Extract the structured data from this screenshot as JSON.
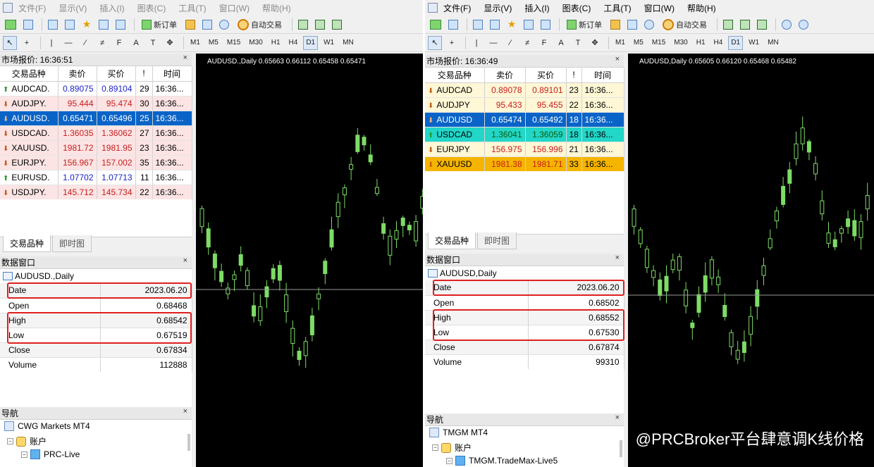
{
  "left": {
    "menu": [
      {
        "label": "文件(F)"
      },
      {
        "label": "显示(V)"
      },
      {
        "label": "插入(I)"
      },
      {
        "label": "图表(C)"
      },
      {
        "label": "工具(T)"
      },
      {
        "label": "窗口(W)"
      },
      {
        "label": "帮助(H)"
      }
    ],
    "toolbar": {
      "new_order": "新订单",
      "auto_trade": "自动交易"
    },
    "periods": [
      "M1",
      "M5",
      "M15",
      "M30",
      "H1",
      "H4",
      "D1",
      "W1",
      "MN"
    ],
    "active_period": "D1",
    "market_watch": {
      "title": "市场报价: 16:36:51",
      "columns": [
        "交易品种",
        "卖价",
        "买价",
        "!",
        "时间"
      ],
      "rows": [
        {
          "symbol": "AUDCAD.",
          "bid": "0.89075",
          "ask": "0.89104",
          "spread": "29",
          "time": "16:36...",
          "dir": "up",
          "bg": "#ffffff"
        },
        {
          "symbol": "AUDJPY.",
          "bid": "95.444",
          "ask": "95.474",
          "spread": "30",
          "time": "16:36...",
          "dir": "down",
          "bg": "#fde4e4"
        },
        {
          "symbol": "AUDUSD.",
          "bid": "0.65471",
          "ask": "0.65496",
          "spread": "25",
          "time": "16:36...",
          "dir": "down",
          "bg": "#0a64c8",
          "selected": true
        },
        {
          "symbol": "USDCAD.",
          "bid": "1.36035",
          "ask": "1.36062",
          "spread": "27",
          "time": "16:36...",
          "dir": "down",
          "bg": "#fde4e4"
        },
        {
          "symbol": "XAUUSD.",
          "bid": "1981.72",
          "ask": "1981.95",
          "spread": "23",
          "time": "16:36...",
          "dir": "down",
          "bg": "#fde4e4"
        },
        {
          "symbol": "EURJPY.",
          "bid": "156.967",
          "ask": "157.002",
          "spread": "35",
          "time": "16:36...",
          "dir": "down",
          "bg": "#fde4e4"
        },
        {
          "symbol": "EURUSD.",
          "bid": "1.07702",
          "ask": "1.07713",
          "spread": "11",
          "time": "16:36...",
          "dir": "up",
          "bg": "#ffffff"
        },
        {
          "symbol": "USDJPY.",
          "bid": "145.712",
          "ask": "145.734",
          "spread": "22",
          "time": "16:36...",
          "dir": "down",
          "bg": "#fde4e4"
        }
      ],
      "tabs": [
        "交易品种",
        "即时图"
      ]
    },
    "data_window": {
      "title": "数据窗口",
      "symbol": "AUDUSD.,Daily",
      "rows": [
        {
          "k": "Date",
          "v": "2023.06.20"
        },
        {
          "k": "Open",
          "v": "0.68468"
        },
        {
          "k": "High",
          "v": "0.68542"
        },
        {
          "k": "Low",
          "v": "0.67519"
        },
        {
          "k": "Close",
          "v": "0.67834"
        },
        {
          "k": "Volume",
          "v": "112888"
        }
      ]
    },
    "navigator": {
      "title": "导航",
      "broker": "CWG Markets MT4",
      "accounts": "账户",
      "server": "PRC-Live"
    },
    "chart": {
      "label": "AUDUSD.,Daily  0.65663 0.66112 0.65458 0.65471"
    }
  },
  "right": {
    "menu": [
      {
        "label": "文件(F)"
      },
      {
        "label": "显示(V)"
      },
      {
        "label": "插入(I)"
      },
      {
        "label": "图表(C)"
      },
      {
        "label": "工具(T)"
      },
      {
        "label": "窗口(W)"
      },
      {
        "label": "帮助(H)"
      }
    ],
    "toolbar": {
      "new_order": "新订单",
      "auto_trade": "自动交易"
    },
    "periods": [
      "M1",
      "M5",
      "M15",
      "M30",
      "H1",
      "H4",
      "D1",
      "W1",
      "MN"
    ],
    "active_period": "D1",
    "market_watch": {
      "title": "市场报价: 16:36:49",
      "columns": [
        "交易品种",
        "卖价",
        "买价",
        "!",
        "时间"
      ],
      "rows": [
        {
          "symbol": "AUDCAD",
          "bid": "0.89078",
          "ask": "0.89101",
          "spread": "23",
          "time": "16:36...",
          "dir": "down",
          "bg": "#fff7d6"
        },
        {
          "symbol": "AUDJPY",
          "bid": "95.433",
          "ask": "95.455",
          "spread": "22",
          "time": "16:36...",
          "dir": "down",
          "bg": "#fff7d6"
        },
        {
          "symbol": "AUDUSD",
          "bid": "0.65474",
          "ask": "0.65492",
          "spread": "18",
          "time": "16:36...",
          "dir": "down",
          "bg": "#0a64c8",
          "selected": true
        },
        {
          "symbol": "USDCAD",
          "bid": "1.36041",
          "ask": "1.36059",
          "spread": "18",
          "time": "16:36...",
          "dir": "up",
          "bg": "#22d6c8"
        },
        {
          "symbol": "EURJPY",
          "bid": "156.975",
          "ask": "156.996",
          "spread": "21",
          "time": "16:36...",
          "dir": "down",
          "bg": "#fff7d6"
        },
        {
          "symbol": "XAUUSD",
          "bid": "1981.38",
          "ask": "1981.71",
          "spread": "33",
          "time": "16:36...",
          "dir": "down",
          "bg": "#f5b400"
        }
      ],
      "tabs": [
        "交易品种",
        "即时图"
      ]
    },
    "data_window": {
      "title": "数据窗口",
      "symbol": "AUDUSD,Daily",
      "rows": [
        {
          "k": "Date",
          "v": "2023.06.20"
        },
        {
          "k": "Open",
          "v": "0.68502"
        },
        {
          "k": "High",
          "v": "0.68552"
        },
        {
          "k": "Low",
          "v": "0.67530"
        },
        {
          "k": "Close",
          "v": "0.67874"
        },
        {
          "k": "Volume",
          "v": "99310"
        }
      ]
    },
    "navigator": {
      "title": "导航",
      "broker": "TMGM MT4",
      "accounts": "账户",
      "server": "TMGM.TradeMax-Live5"
    },
    "chart": {
      "label": "AUDUSD,Daily  0.65605 0.66120 0.65468 0.65482"
    }
  },
  "watermark": "@PRCBroker平台肆意调K线价格",
  "colors": {
    "bull": "#7ddc66",
    "bear": "#7ddc66",
    "chart_bg": "#000000",
    "highlight": "#e02020"
  }
}
